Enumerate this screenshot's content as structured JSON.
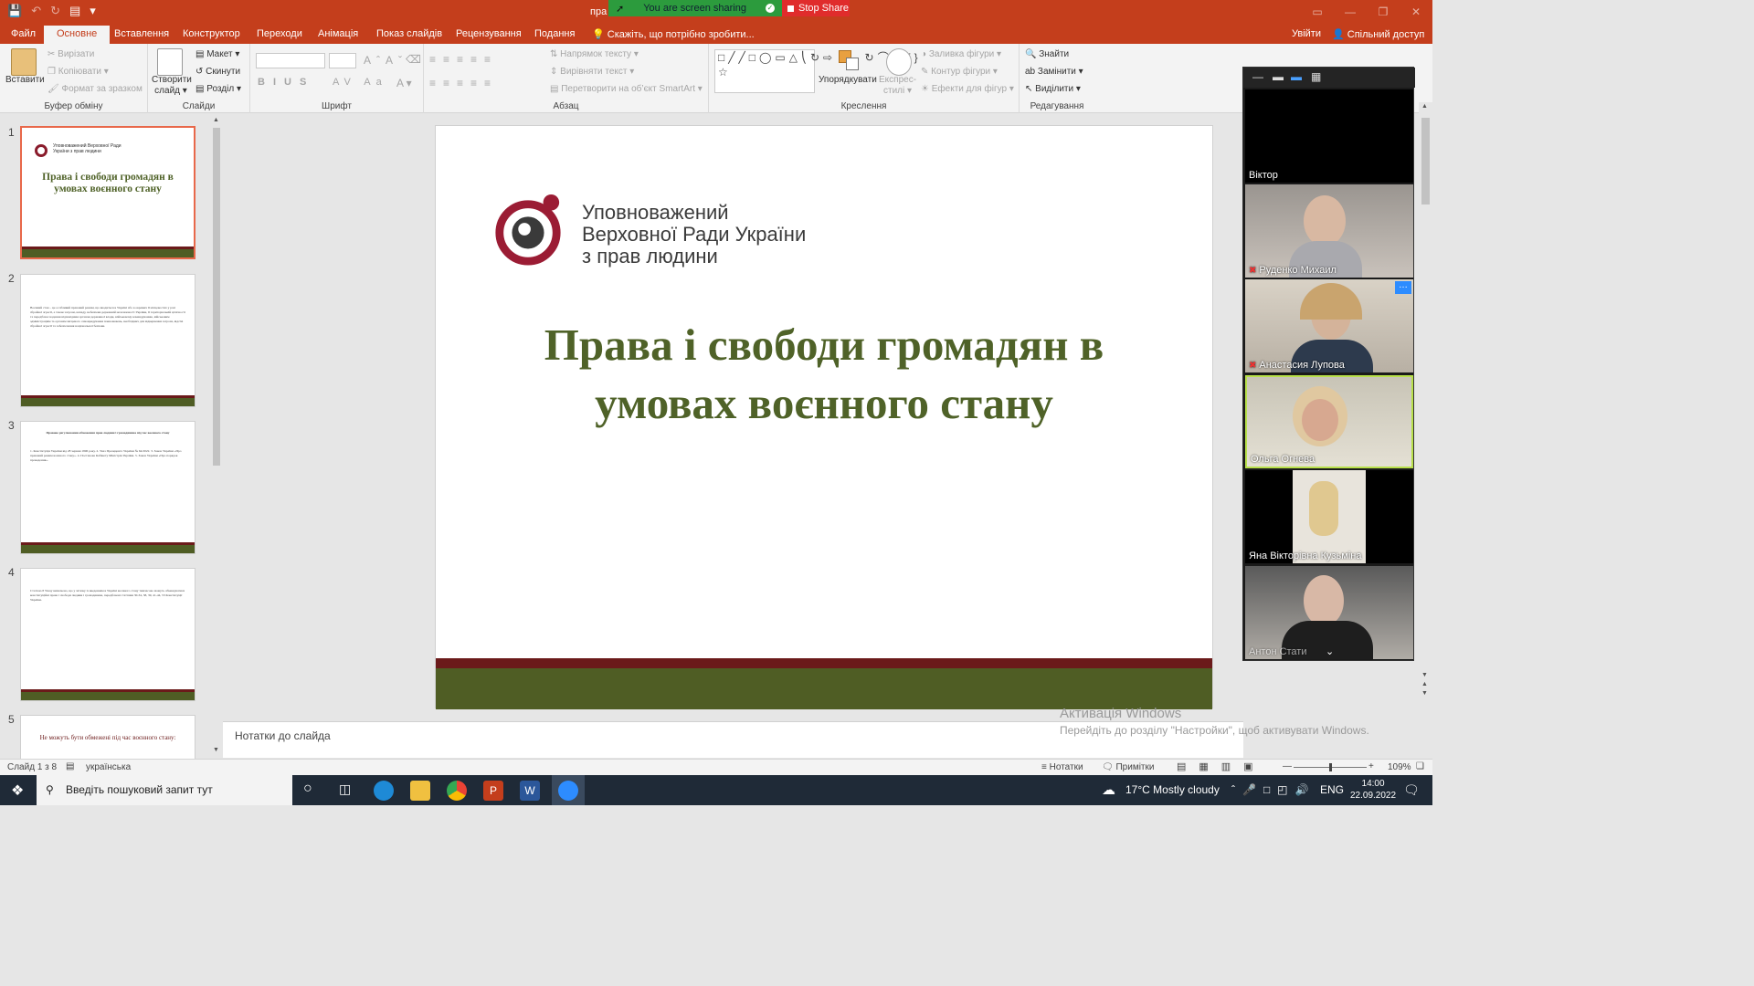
{
  "titlebar": {
    "doc_title": "пра",
    "sharing_label": "You are screen sharing",
    "stop_share_label": "Stop Share",
    "qat_icons": [
      "save-icon",
      "undo-icon",
      "redo-icon",
      "present-from-start-icon",
      "customize-icon"
    ]
  },
  "tabs": {
    "file": "Файл",
    "home": "Основне",
    "insert": "Вставлення",
    "design": "Конструктор",
    "transitions": "Переходи",
    "animations": "Анімація",
    "slideshow": "Показ слайдів",
    "review": "Рецензування",
    "view": "Подання",
    "tellme": "Скажіть, що потрібно зробити...",
    "signin": "Увійти",
    "share": "Спільний доступ"
  },
  "ribbon": {
    "clipboard": {
      "paste": "Вставити",
      "cut": "Вирізати",
      "copy": "Копіювати",
      "format_painter": "Формат за зразком",
      "label": "Буфер обміну"
    },
    "slides": {
      "new_slide_1": "Створити",
      "new_slide_2": "слайд",
      "layout": "Макет",
      "reset": "Скинути",
      "section": "Розділ",
      "label": "Слайди"
    },
    "font": {
      "label": "Шрифт"
    },
    "paragraph": {
      "text_direction": "Напрямок тексту",
      "align_text": "Вирівняти текст",
      "smartart": "Перетворити на об’єкт SmartArt",
      "label": "Абзац"
    },
    "drawing": {
      "arrange": "Упорядкувати",
      "quick_styles_1": "Експрес-",
      "quick_styles_2": "стилі",
      "fill": "Заливка фігури",
      "outline": "Контур фігури",
      "effects": "Ефекти для фігур",
      "label": "Креслення"
    },
    "editing": {
      "find": "Знайти",
      "replace": "Замінити",
      "select": "Виділити",
      "label": "Редагування"
    }
  },
  "thumbnails": [
    {
      "num": "1",
      "title": "Права і свободи громадян в умовах воєнного стану",
      "org": "Уповноважений Верховної Ради України з прав людини"
    },
    {
      "num": "2",
      "text": "Воєнний стан – це особливий правовий режим, що вводиться в Україні або в окремих її місцевостях у разі збройної агресії, а також загрози, нападу, небезпеки державній незалежності України, її територіальній цілісності та передбачає надання відповідним органам державної влади, військовому командуванню, військовим адміністраціям та органам місцевого самоврядування повноважень, необхідних для відвернення загрози, відсічі збройної агресії та забезпечення національної безпеки."
    },
    {
      "num": "3",
      "title": "Правове регулювання обмеження прав людини і громадянина під час воєнного стану",
      "text": "1. Конституція України від 28 червня 1996 року. 2. Указ Президента України № 64/2022. 3. Закон України «Про правовий режим воєнного стану». 4. Постанова Кабінету Міністрів України. 5. Закон України «Про порядок проведення»."
    },
    {
      "num": "4",
      "text": "Статтею 8 Указу визначено, що у зв’язку із введенням в Україні воєнного стану тимчасово можуть обмежуватися конституційні права і свободи людини і громадянина, передбачені статтями 30-34, 38, 39, 41-44, 53 Конституції України."
    },
    {
      "num": "5",
      "title": "Не можуть бути обмежені під час воєнного стану:"
    }
  ],
  "slide": {
    "org_line1": "Уповноважений",
    "org_line2": "Верховної Ради України",
    "org_line3": "з прав людини",
    "title_line1": "Права і свободи громадян в",
    "title_line2": "умовах воєнного стану"
  },
  "notes_placeholder": "Нотатки до слайда",
  "watermark": {
    "line1": "Активація Windows",
    "line2": "Перейдіть до розділу \"Настройки\", щоб активувати Windows."
  },
  "participants": [
    {
      "name": "Віктор",
      "muted": false
    },
    {
      "name": "Руденко Михаил",
      "muted": true
    },
    {
      "name": "Анастасия Лупова",
      "muted": true
    },
    {
      "name": "Ольга Огнева",
      "muted": false
    },
    {
      "name": "Яна Вікторівна Кузьміна",
      "muted": false
    },
    {
      "name": "Антон Стати",
      "muted": false
    }
  ],
  "statusbar": {
    "slide_info": "Слайд 1 з 8",
    "language": "українська",
    "notes": "Нотатки",
    "comments": "Примітки",
    "zoom": "109%"
  },
  "taskbar": {
    "search_placeholder": "Введіть пошуковий запит тут",
    "weather": "17°C  Mostly cloudy",
    "lang": "ENG",
    "time": "14:00",
    "date": "22.09.2022",
    "apps": [
      "start-icon",
      "search-icon",
      "cortana-icon",
      "task-view-icon",
      "edge-icon",
      "file-explorer-icon",
      "chrome-icon",
      "powerpoint-icon",
      "word-icon",
      "zoom-icon"
    ]
  },
  "colors": {
    "ppt_accent": "#c43e1c",
    "title_green": "#4f6228",
    "band_dark_red": "#6b1a1a",
    "band_olive": "#4f5d24",
    "sharing_green": "#2c9b3d",
    "stop_red": "#e02c2c"
  }
}
